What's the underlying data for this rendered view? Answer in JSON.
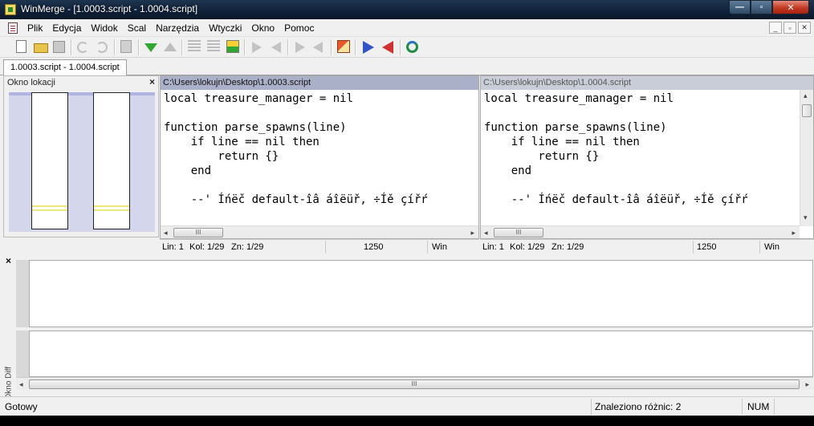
{
  "window": {
    "title": "WinMerge - [1.0003.script - 1.0004.script]",
    "buttons": {
      "minimize": "—",
      "maximize": "▫",
      "close": "✕"
    }
  },
  "menu": {
    "items": [
      "Plik",
      "Edycja",
      "Widok",
      "Scal",
      "Narzędzia",
      "Wtyczki",
      "Okno",
      "Pomoc"
    ],
    "mdi": {
      "minimize": "_",
      "restore": "▫",
      "close": "✕"
    }
  },
  "tabs": [
    {
      "label": "1.0003.script - 1.0004.script"
    }
  ],
  "location_pane": {
    "title": "Okno lokacji",
    "close": "×"
  },
  "left_pane": {
    "path": "C:\\Users\\lokujn\\Desktop\\1.0003.script",
    "code": "local treasure_manager = nil\n\nfunction parse_spawns(line)\n    if line == nil then\n        return {}\n    end\n\n    --' Íńëč default-îâ áîëüř, ÷Íě çířŕ",
    "status": {
      "line": "Lin: 1",
      "col": "Kol: 1/29",
      "char": "Zn: 1/29",
      "encoding": "1250",
      "eol": "Win"
    }
  },
  "right_pane": {
    "path": "C:\\Users\\lokujn\\Desktop\\1.0004.script",
    "code": "local treasure_manager = nil\n\nfunction parse_spawns(line)\n    if line == nil then\n        return {}\n    end\n\n    --' Íńëč default-îâ áîëüř, ÷Íě çířŕ",
    "status": {
      "line": "Lin: 1",
      "col": "Kol: 1/29",
      "char": "Zn: 1/29",
      "encoding": "1250",
      "eol": "Win"
    }
  },
  "scroll": {
    "thumb_grip": "III",
    "left": "◂",
    "right": "▸",
    "up": "▴",
    "down": "▾"
  },
  "diff_pane": {
    "title": "Okno Diff",
    "close": "×"
  },
  "statusbar": {
    "ready": "Gotowy",
    "differences": "Znaleziono różnic: 2",
    "num": "NUM"
  }
}
